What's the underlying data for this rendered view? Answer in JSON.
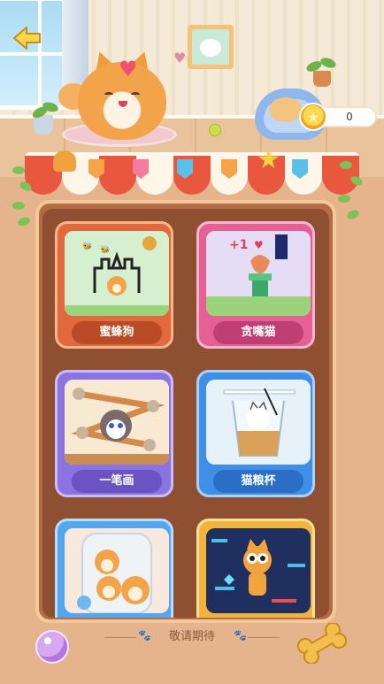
{
  "header": {
    "coin_value": "0"
  },
  "games": [
    {
      "label": "蜜蜂狗",
      "theme": "orange"
    },
    {
      "label": "贪嘴猫",
      "theme": "pink"
    },
    {
      "label": "一笔画",
      "theme": "purple"
    },
    {
      "label": "猫粮杯",
      "theme": "blue"
    },
    {
      "label": "",
      "theme": "sky"
    },
    {
      "label": "",
      "theme": "gold"
    }
  ],
  "footer": {
    "text": "敬请期待"
  },
  "icons": {
    "back": "back-arrow-icon",
    "coin": "star-coin-icon",
    "footer_left": "crystal-ball-icon",
    "footer_right": "bone-icon",
    "paw": "paw-icon"
  },
  "colors": {
    "tile_orange": "#e2683e",
    "tile_pink": "#e56193",
    "tile_purple": "#8b73e0",
    "tile_blue": "#3f8ee8",
    "tile_sky": "#53a7f0",
    "tile_gold": "#f2b33a",
    "board": "#b36c45",
    "background": "#e6b48c"
  }
}
